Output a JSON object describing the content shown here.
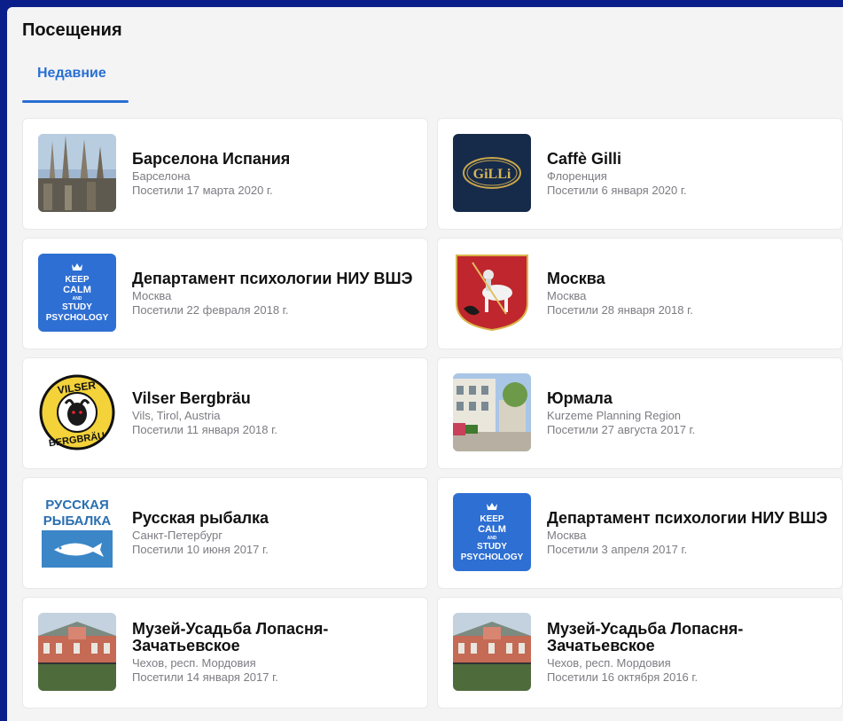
{
  "page": {
    "title": "Посещения"
  },
  "tabs": [
    {
      "label": "Недавние",
      "active": true
    }
  ],
  "colors": {
    "accent": "#2a6fd1",
    "frame": "#0b1f8a"
  },
  "visits": [
    {
      "name": "Барселона Испания",
      "location": "Барселона",
      "visited": "Посетили 17 марта 2020 г.",
      "thumb": "cathedral-photo"
    },
    {
      "name": "Caffè Gilli",
      "location": "Флоренция",
      "visited": "Посетили 6 января 2020 г.",
      "thumb": "gilli-logo",
      "logo_text": "GiLLi"
    },
    {
      "name": "Департамент психологии НИУ ВШЭ",
      "location": "Москва",
      "visited": "Посетили 22 февраля 2018 г.",
      "thumb": "keep-calm-logo",
      "logo_lines": [
        "KEEP",
        "CALM",
        "AND",
        "STUDY",
        "PSYCHOLOGY"
      ]
    },
    {
      "name": "Москва",
      "location": "Москва",
      "visited": "Посетили 28 января 2018 г.",
      "thumb": "moscow-coat-of-arms"
    },
    {
      "name": "Vilser Bergbräu",
      "location": "Vils, Tirol, Austria",
      "visited": "Посетили 11 января 2018 г.",
      "thumb": "vilser-logo",
      "logo_lines": [
        "VILSER",
        "BERGBRÄU"
      ]
    },
    {
      "name": "Юрмала",
      "location": "Kurzeme Planning Region",
      "visited": "Посетили 27 августа 2017 г.",
      "thumb": "street-photo"
    },
    {
      "name": "Русская рыбалка",
      "location": "Санкт-Петербург",
      "visited": "Посетили 10 июня 2017 г.",
      "thumb": "fishing-logo",
      "logo_lines": [
        "РУССКАЯ",
        "РЫБАЛКА"
      ]
    },
    {
      "name": "Департамент психологии НИУ ВШЭ",
      "location": "Москва",
      "visited": "Посетили 3 апреля 2017 г.",
      "thumb": "keep-calm-logo",
      "logo_lines": [
        "KEEP",
        "CALM",
        "AND",
        "STUDY",
        "PSYCHOLOGY"
      ]
    },
    {
      "name": "Музей-Усадьба Лопасня-Зачатьевское",
      "location": "Чехов, респ. Мордовия",
      "visited": "Посетили 14 января 2017 г.",
      "thumb": "manor-photo"
    },
    {
      "name": "Музей-Усадьба Лопасня-Зачатьевское",
      "location": "Чехов, респ. Мордовия",
      "visited": "Посетили 16 октября 2016 г.",
      "thumb": "manor-photo"
    }
  ]
}
